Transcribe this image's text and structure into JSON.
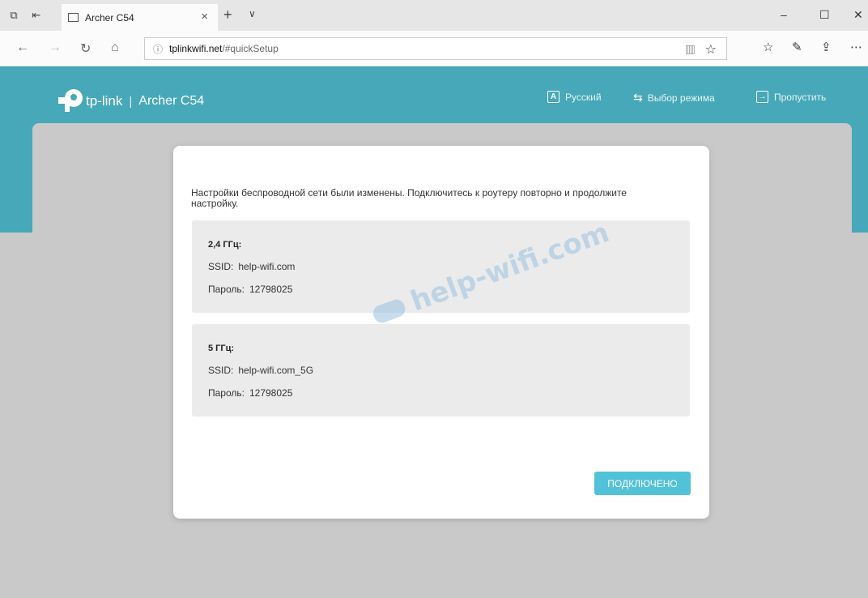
{
  "browser": {
    "tab_title": "Archer C54",
    "tab_close": "×",
    "new_tab": "+",
    "tab_menu": "∨",
    "win_min": "–",
    "win_max": "☐",
    "win_close": "✕",
    "url_host": "tplinkwifi.net",
    "url_path": "/#quickSetup"
  },
  "header": {
    "brand": "tp-link",
    "separator": "|",
    "model": "Archer C54",
    "language": "Русский",
    "mode": "Выбор режима",
    "skip": "Пропустить"
  },
  "dialog": {
    "message": "Настройки беспроводной сети были изменены. Подключитесь к роутеру повторно и продолжите настройку.",
    "networks": [
      {
        "band": "2,4 ГГц:",
        "ssid_label": "SSID:",
        "ssid": "help-wifi.com",
        "password_label": "Пароль:",
        "password": "12798025"
      },
      {
        "band": "5 ГГц:",
        "ssid_label": "SSID:",
        "ssid": "help-wifi.com_5G",
        "password_label": "Пароль:",
        "password": "12798025"
      }
    ],
    "button": "ПОДКЛЮЧЕНО"
  },
  "watermark": "help-wifi.com",
  "colors": {
    "accent": "#46a8b8",
    "button": "#52c2d8",
    "background": "#c9c9c9"
  }
}
